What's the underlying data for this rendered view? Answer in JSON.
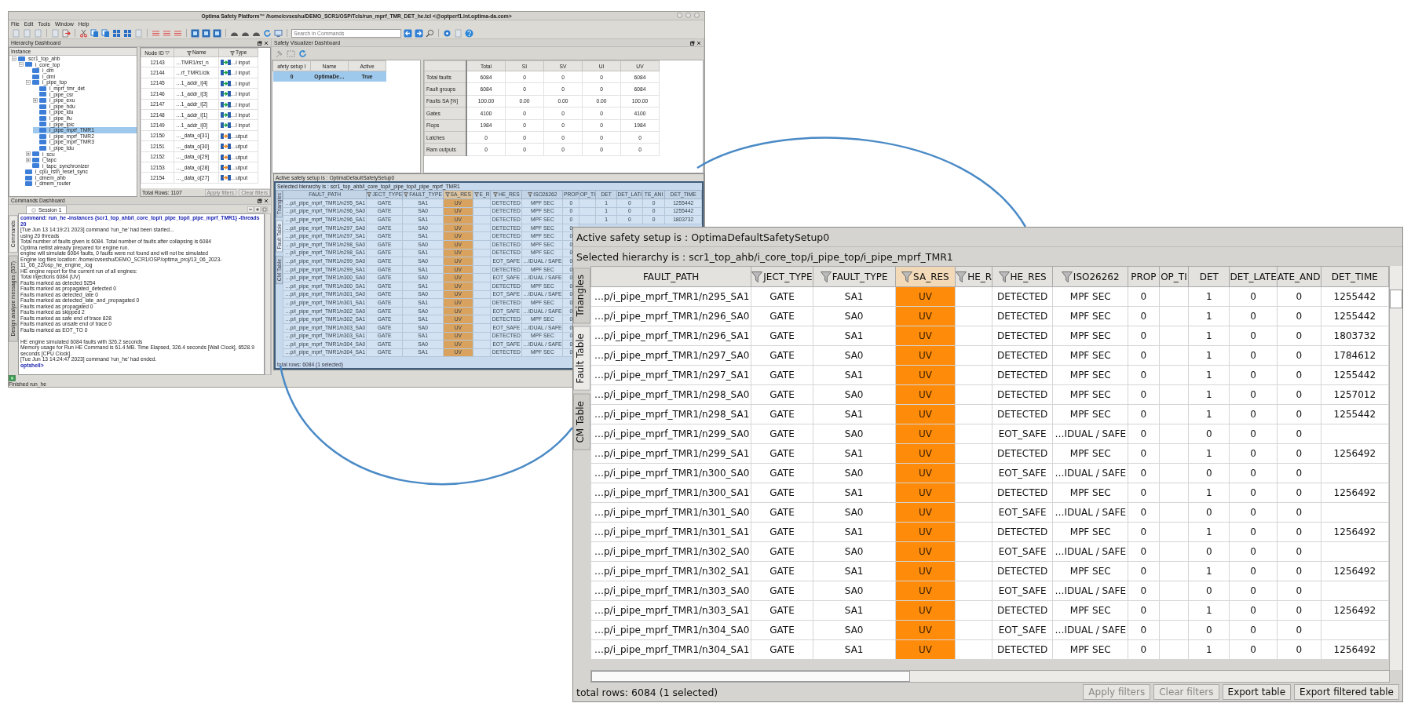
{
  "window": {
    "title": "Optima Safety Platform™ /home/cvseshu/DEMO_SCR1/OSP/Tcls/run_mprf_TMR_DET_he.tcl <@optperf1.int.optima-da.com>",
    "menu": [
      "File",
      "Edit",
      "Tools",
      "Window",
      "Help"
    ],
    "search": {
      "placeholder": "Search in Commands"
    }
  },
  "hierarchy_dashboard": {
    "title": "Hierarchy Dashboard",
    "tree": {
      "header": "Instance",
      "nodes": [
        {
          "label": "scr1_top_ahb",
          "expanded": true,
          "selected": false,
          "children": [
            {
              "label": "i_core_top",
              "expanded": true,
              "selected": false,
              "children": [
                {
                  "label": "i_dm",
                  "selected": false
                },
                {
                  "label": "i_dmi",
                  "selected": false
                },
                {
                  "label": "i_pipe_top",
                  "expanded": true,
                  "selected": false,
                  "children": [
                    {
                      "label": "i_mprf_tmr_det",
                      "selected": false
                    },
                    {
                      "label": "i_pipe_csr",
                      "selected": false
                    },
                    {
                      "label": "i_pipe_exu",
                      "expanded": false,
                      "selected": false
                    },
                    {
                      "label": "i_pipe_hdu",
                      "selected": false
                    },
                    {
                      "label": "i_pipe_idu",
                      "selected": false
                    },
                    {
                      "label": "i_pipe_ifu",
                      "selected": false
                    },
                    {
                      "label": "i_pipe_ipic",
                      "selected": false
                    },
                    {
                      "label": "i_pipe_mprf_TMR1",
                      "selected": true
                    },
                    {
                      "label": "i_pipe_mprf_TMR2",
                      "selected": false
                    },
                    {
                      "label": "i_pipe_mprf_TMR3",
                      "selected": false
                    },
                    {
                      "label": "i_pipe_tdu",
                      "selected": false
                    }
                  ]
                },
                {
                  "label": "i_scu",
                  "expanded": false,
                  "selected": false
                },
                {
                  "label": "i_tapc",
                  "expanded": false,
                  "selected": false
                },
                {
                  "label": "i_tapc_synchronizer",
                  "selected": false
                }
              ]
            },
            {
              "label": "i_cpu_rstn_reset_sync",
              "selected": false
            },
            {
              "label": "i_dmem_ahb",
              "selected": false
            },
            {
              "label": "i_dmem_router",
              "selected": false
            }
          ]
        }
      ]
    },
    "node_table": {
      "columns": [
        {
          "label": "Node ID",
          "sorted": true,
          "filter": false
        },
        {
          "label": "Name",
          "sorted": false,
          "filter": true
        },
        {
          "label": "Type",
          "sorted": false,
          "filter": true
        }
      ],
      "rows": [
        {
          "node_id": "12143",
          "name": "…TMR1/rst_n",
          "kind": "input",
          "type": "…l input"
        },
        {
          "node_id": "12144",
          "name": "…rf_TMR1/clk",
          "kind": "input",
          "type": "…l input"
        },
        {
          "node_id": "12145",
          "name": "…1_addr_i[4]",
          "kind": "input",
          "type": "…l input"
        },
        {
          "node_id": "12146",
          "name": "…1_addr_i[3]",
          "kind": "input",
          "type": "…l input"
        },
        {
          "node_id": "12147",
          "name": "…1_addr_i[2]",
          "kind": "input",
          "type": "…l input"
        },
        {
          "node_id": "12148",
          "name": "…1_addr_i[1]",
          "kind": "input",
          "type": "…l input"
        },
        {
          "node_id": "12149",
          "name": "…1_addr_i[0]",
          "kind": "input",
          "type": "…l input"
        },
        {
          "node_id": "12150",
          "name": "…_data_o[31]",
          "kind": "output",
          "type": "…utput"
        },
        {
          "node_id": "12151",
          "name": "…_data_o[30]",
          "kind": "output",
          "type": "…utput"
        },
        {
          "node_id": "12152",
          "name": "…_data_o[29]",
          "kind": "output",
          "type": "…utput"
        },
        {
          "node_id": "12153",
          "name": "…_data_o[28]",
          "kind": "output",
          "type": "…utput"
        },
        {
          "node_id": "12154",
          "name": "…_data_o[27]",
          "kind": "output",
          "type": "…utput"
        }
      ],
      "total": "Total Rows: 1107",
      "buttons": [
        {
          "label": "Apply filters",
          "disabled": true
        },
        {
          "label": "Clear filters",
          "disabled": true
        }
      ]
    }
  },
  "commands_dashboard": {
    "title": "Commands Dashboard",
    "tabs": [
      {
        "label": "Session 1",
        "selected": true
      }
    ],
    "side_tabs": [
      {
        "label": "Commands",
        "selected": true
      },
      {
        "label": "Design analyze messages (537)",
        "selected": false
      }
    ],
    "log": [
      {
        "kind": "command",
        "text": "command: run_he -instances {scr1_top_ahb/i_core_top/i_pipe_top/i_pipe_mprf_TMR1} -threads 20"
      },
      {
        "kind": "text",
        "text": "[Tue Jun 13 14:19:21 2023] command 'run_he' had been started..."
      },
      {
        "kind": "text",
        "text": "using 20 threads"
      },
      {
        "kind": "text",
        "text": "Total number of faults given is 6084. Total number of faults after collapsing is 6084"
      },
      {
        "kind": "text",
        "text": "Optima netlist already prepared for engine run."
      },
      {
        "kind": "text",
        "text": "engine will simulate 6084 faults, 0 faults were not found and will not be simulated"
      },
      {
        "kind": "text",
        "text": "Engine log files location: /home/cvseshu/DEMO_SCR1/OSP/optima_proj/13_06_2023-11_06_22/osp_he_engine_.log"
      },
      {
        "kind": "text",
        "text": "HE engine report for the current run of all engines:"
      },
      {
        "kind": "text",
        "text": "Total injections 6084 (UV)"
      },
      {
        "kind": "text",
        "text": "Faults marked as detected 5254"
      },
      {
        "kind": "text",
        "text": "Faults marked as propagated_detected 0"
      },
      {
        "kind": "text",
        "text": "Faults marked as detected_late 0"
      },
      {
        "kind": "text",
        "text": "Faults marked as detected_late_and_propagated 0"
      },
      {
        "kind": "text",
        "text": "Faults marked as propagated 0"
      },
      {
        "kind": "text",
        "text": "Faults marked as skipped 2"
      },
      {
        "kind": "text",
        "text": "Faults marked as safe end of trace 828"
      },
      {
        "kind": "text",
        "text": "Faults marked as unsafe end of trace 0"
      },
      {
        "kind": "text",
        "text": "Faults marked as EOT_TO 0"
      },
      {
        "kind": "text",
        "gap_before": true,
        "text": "HE engine simulated 6084 faults with 326.2 seconds"
      },
      {
        "kind": "text",
        "text": "Memory usage for Run HE Command is 61.4 MB. Time Elapsed, 326.4 seconds [Wall Clock], 6528.9 seconds [CPU Clock]."
      },
      {
        "kind": "text",
        "text": "[Tue Jun 13 14:24:47 2023] command 'run_he' had ended."
      },
      {
        "kind": "prompt",
        "text": "optshell>"
      }
    ]
  },
  "safety_visualizer": {
    "title": "Safety Visualizer Dashboard",
    "setups": {
      "columns": [
        "afety setup I",
        "Name",
        "Active"
      ],
      "rows": [
        {
          "cells": [
            "0",
            "OptimaDe…",
            "True"
          ],
          "selected": true
        }
      ]
    },
    "summary": {
      "columns": [
        "Total",
        "SI",
        "SV",
        "UI",
        "UV"
      ],
      "rows": [
        {
          "label": "Total faults",
          "values": [
            "6084",
            "0",
            "0",
            "0",
            "6084"
          ]
        },
        {
          "label": "Fault groups",
          "values": [
            "6084",
            "0",
            "0",
            "0",
            "6084"
          ]
        },
        {
          "label": "Faults SA [%]",
          "values": [
            "100.00",
            "0.00",
            "0.00",
            "0.00",
            "100.00"
          ]
        },
        {
          "label": "Gates",
          "values": [
            "4100",
            "0",
            "0",
            "0",
            "4100"
          ]
        },
        {
          "label": "Flops",
          "values": [
            "1984",
            "0",
            "0",
            "0",
            "1984"
          ]
        },
        {
          "label": "Latches",
          "values": [
            "0",
            "0",
            "0",
            "0",
            "0"
          ]
        },
        {
          "label": "Ram outputs",
          "values": [
            "0",
            "0",
            "0",
            "0",
            "0"
          ]
        }
      ]
    }
  },
  "fault_window": {
    "active_setup": "Active safety setup is : OptimaDefaultSafetySetup0",
    "selected_hierarchy": "Selected hierarchy is : scr1_top_ahb/i_core_top/i_pipe_top/i_pipe_mprf_TMR1",
    "side_tabs": [
      {
        "label": "Triangles",
        "selected": false
      },
      {
        "label": "Fault Table",
        "selected": true
      },
      {
        "label": "CM Table",
        "selected": false
      }
    ],
    "columns": [
      {
        "label": "FAULT_PATH",
        "filter": false,
        "highlighted": false
      },
      {
        "label": "JECT_TYPE",
        "filter": true,
        "highlighted": false
      },
      {
        "label": "FAULT_TYPE",
        "filter": true,
        "highlighted": false
      },
      {
        "label": "SA_RES",
        "filter": true,
        "highlighted": true
      },
      {
        "label": "E_R",
        "filter": true,
        "highlighted": false
      },
      {
        "label": "HE_RES",
        "filter": true,
        "highlighted": false
      },
      {
        "label": "ISO26262",
        "filter": true,
        "highlighted": false
      },
      {
        "label": "PROP",
        "filter": false,
        "highlighted": false
      },
      {
        "label": "OP_TI",
        "filter": false,
        "highlighted": false
      },
      {
        "label": "DET",
        "filter": false,
        "highlighted": false
      },
      {
        "label": "DET_LATI",
        "filter": false,
        "highlighted": false
      },
      {
        "label": "TE_ANI",
        "filter": false,
        "highlighted": false
      },
      {
        "label": "DET_TIME",
        "filter": false,
        "highlighted": false
      }
    ],
    "rows": [
      [
        "…p/i_pipe_mprf_TMR1/n295_SA1",
        "GATE",
        "SA1",
        "UV",
        null,
        "DETECTED",
        "MPF SEC",
        "0",
        null,
        "1",
        "0",
        "0",
        "1255442"
      ],
      [
        "…p/i_pipe_mprf_TMR1/n296_SA0",
        "GATE",
        "SA0",
        "UV",
        null,
        "DETECTED",
        "MPF SEC",
        "0",
        null,
        "1",
        "0",
        "0",
        "1255442"
      ],
      [
        "…p/i_pipe_mprf_TMR1/n296_SA1",
        "GATE",
        "SA1",
        "UV",
        null,
        "DETECTED",
        "MPF SEC",
        "0",
        null,
        "1",
        "0",
        "0",
        "1803732"
      ],
      [
        "…p/i_pipe_mprf_TMR1/n297_SA0",
        "GATE",
        "SA0",
        "UV",
        null,
        "DETECTED",
        "MPF SEC",
        "0"
      ],
      [
        "…p/i_pipe_mprf_TMR1/n297_SA1",
        "GATE",
        "SA1",
        "UV",
        null,
        "DETECTED",
        "MPF SEC",
        "0"
      ],
      [
        "…p/i_pipe_mprf_TMR1/n298_SA0",
        "GATE",
        "SA0",
        "UV",
        null,
        "DETECTED",
        "MPF SEC",
        "0"
      ],
      [
        "…p/i_pipe_mprf_TMR1/n298_SA1",
        "GATE",
        "SA1",
        "UV",
        null,
        "DETECTED",
        "MPF SEC",
        "0"
      ],
      [
        "…p/i_pipe_mprf_TMR1/n299_SA0",
        "GATE",
        "SA0",
        "UV",
        null,
        "EOT_SAFE",
        "…IDUAL / SAFE",
        "0"
      ],
      [
        "…p/i_pipe_mprf_TMR1/n299_SA1",
        "GATE",
        "SA1",
        "UV",
        null,
        "DETECTED",
        "MPF SEC",
        "0"
      ],
      [
        "…p/i_pipe_mprf_TMR1/n300_SA0",
        "GATE",
        "SA0",
        "UV",
        null,
        "EOT_SAFE",
        "…IDUAL / SAFE",
        "0"
      ],
      [
        "…p/i_pipe_mprf_TMR1/n300_SA1",
        "GATE",
        "SA1",
        "UV",
        null,
        "DETECTED",
        "MPF SEC",
        "0"
      ],
      [
        "…p/i_pipe_mprf_TMR1/n301_SA0",
        "GATE",
        "SA0",
        "UV",
        null,
        "EOT_SAFE",
        "…IDUAL / SAFE",
        "0"
      ],
      [
        "…p/i_pipe_mprf_TMR1/n301_SA1",
        "GATE",
        "SA1",
        "UV",
        null,
        "DETECTED",
        "MPF SEC",
        "0"
      ],
      [
        "…p/i_pipe_mprf_TMR1/n302_SA0",
        "GATE",
        "SA0",
        "UV",
        null,
        "EOT_SAFE",
        "…IDUAL / SAFE",
        "0"
      ],
      [
        "…p/i_pipe_mprf_TMR1/n302_SA1",
        "GATE",
        "SA1",
        "UV",
        null,
        "DETECTED",
        "MPF SEC",
        "0"
      ],
      [
        "…p/i_pipe_mprf_TMR1/n303_SA0",
        "GATE",
        "SA0",
        "UV",
        null,
        "EOT_SAFE",
        "…IDUAL / SAFE",
        "0"
      ],
      [
        "…p/i_pipe_mprf_TMR1/n303_SA1",
        "GATE",
        "SA1",
        "UV",
        null,
        "DETECTED",
        "MPF SEC",
        "0"
      ],
      [
        "…p/i_pipe_mprf_TMR1/n304_SA0",
        "GATE",
        "SA0",
        "UV",
        null,
        "EOT_SAFE",
        "…IDUAL / SAFE",
        "0"
      ],
      [
        "…p/i_pipe_mprf_TMR1/n304_SA1",
        "GATE",
        "SA1",
        "UV",
        null,
        "DETECTED",
        "MPF SEC",
        "0"
      ]
    ],
    "total": "total rows: 6084 (1 selected)"
  },
  "status_bar": {
    "text": "Finished run_he"
  },
  "zoom_panel": {
    "active_setup": "Active safety setup is : OptimaDefaultSafetySetup0",
    "selected_hierarchy": "Selected hierarchy is : scr1_top_ahb/i_core_top/i_pipe_top/i_pipe_mprf_TMR1",
    "side_tabs": [
      {
        "label": "Triangles",
        "selected": false
      },
      {
        "label": "Fault Table",
        "selected": true
      },
      {
        "label": "CM Table",
        "selected": false
      }
    ],
    "columns": [
      {
        "label": "FAULT_PATH",
        "filter": false,
        "highlighted": false
      },
      {
        "label": "JECT_TYPE",
        "filter": true,
        "highlighted": false
      },
      {
        "label": "FAULT_TYPE",
        "filter": true,
        "highlighted": false
      },
      {
        "label": "SA_RES",
        "filter": true,
        "highlighted": true
      },
      {
        "label": "HE_R",
        "filter": true,
        "highlighted": false
      },
      {
        "label": "HE_RES",
        "filter": true,
        "highlighted": false
      },
      {
        "label": "ISO26262",
        "filter": true,
        "highlighted": false
      },
      {
        "label": "PROP",
        "filter": false,
        "highlighted": false
      },
      {
        "label": "OP_TI",
        "filter": false,
        "highlighted": false
      },
      {
        "label": "DET",
        "filter": false,
        "highlighted": false
      },
      {
        "label": "DET_LATE",
        "filter": false,
        "highlighted": false
      },
      {
        "label": "ATE_AND",
        "filter": false,
        "highlighted": false
      },
      {
        "label": "DET_TIME",
        "filter": false,
        "highlighted": false
      }
    ],
    "rows": [
      [
        "…p/i_pipe_mprf_TMR1/n295_SA1",
        "GATE",
        "SA1",
        "UV",
        null,
        "DETECTED",
        "MPF SEC",
        "0",
        null,
        "1",
        "0",
        "0",
        "1255442"
      ],
      [
        "…p/i_pipe_mprf_TMR1/n296_SA0",
        "GATE",
        "SA0",
        "UV",
        null,
        "DETECTED",
        "MPF SEC",
        "0",
        null,
        "1",
        "0",
        "0",
        "1255442"
      ],
      [
        "…p/i_pipe_mprf_TMR1/n296_SA1",
        "GATE",
        "SA1",
        "UV",
        null,
        "DETECTED",
        "MPF SEC",
        "0",
        null,
        "1",
        "0",
        "0",
        "1803732"
      ],
      [
        "…p/i_pipe_mprf_TMR1/n297_SA0",
        "GATE",
        "SA0",
        "UV",
        null,
        "DETECTED",
        "MPF SEC",
        "0",
        null,
        "1",
        "0",
        "0",
        "1784612"
      ],
      [
        "…p/i_pipe_mprf_TMR1/n297_SA1",
        "GATE",
        "SA1",
        "UV",
        null,
        "DETECTED",
        "MPF SEC",
        "0",
        null,
        "1",
        "0",
        "0",
        "1255442"
      ],
      [
        "…p/i_pipe_mprf_TMR1/n298_SA0",
        "GATE",
        "SA0",
        "UV",
        null,
        "DETECTED",
        "MPF SEC",
        "0",
        null,
        "1",
        "0",
        "0",
        "1257012"
      ],
      [
        "…p/i_pipe_mprf_TMR1/n298_SA1",
        "GATE",
        "SA1",
        "UV",
        null,
        "DETECTED",
        "MPF SEC",
        "0",
        null,
        "1",
        "0",
        "0",
        "1255442"
      ],
      [
        "…p/i_pipe_mprf_TMR1/n299_SA0",
        "GATE",
        "SA0",
        "UV",
        null,
        "EOT_SAFE",
        "…IDUAL / SAFE",
        "0",
        null,
        "0",
        "0",
        "0",
        null
      ],
      [
        "…p/i_pipe_mprf_TMR1/n299_SA1",
        "GATE",
        "SA1",
        "UV",
        null,
        "DETECTED",
        "MPF SEC",
        "0",
        null,
        "1",
        "0",
        "0",
        "1256492"
      ],
      [
        "…p/i_pipe_mprf_TMR1/n300_SA0",
        "GATE",
        "SA0",
        "UV",
        null,
        "EOT_SAFE",
        "…IDUAL / SAFE",
        "0",
        null,
        "0",
        "0",
        "0",
        null
      ],
      [
        "…p/i_pipe_mprf_TMR1/n300_SA1",
        "GATE",
        "SA1",
        "UV",
        null,
        "DETECTED",
        "MPF SEC",
        "0",
        null,
        "1",
        "0",
        "0",
        "1256492"
      ],
      [
        "…p/i_pipe_mprf_TMR1/n301_SA0",
        "GATE",
        "SA0",
        "UV",
        null,
        "EOT_SAFE",
        "…IDUAL / SAFE",
        "0",
        null,
        "0",
        "0",
        "0",
        null
      ],
      [
        "…p/i_pipe_mprf_TMR1/n301_SA1",
        "GATE",
        "SA1",
        "UV",
        null,
        "DETECTED",
        "MPF SEC",
        "0",
        null,
        "1",
        "0",
        "0",
        "1256492"
      ],
      [
        "…p/i_pipe_mprf_TMR1/n302_SA0",
        "GATE",
        "SA0",
        "UV",
        null,
        "EOT_SAFE",
        "…IDUAL / SAFE",
        "0",
        null,
        "0",
        "0",
        "0",
        null
      ],
      [
        "…p/i_pipe_mprf_TMR1/n302_SA1",
        "GATE",
        "SA1",
        "UV",
        null,
        "DETECTED",
        "MPF SEC",
        "0",
        null,
        "1",
        "0",
        "0",
        "1256492"
      ],
      [
        "…p/i_pipe_mprf_TMR1/n303_SA0",
        "GATE",
        "SA0",
        "UV",
        null,
        "EOT_SAFE",
        "…IDUAL / SAFE",
        "0",
        null,
        "0",
        "0",
        "0",
        null
      ],
      [
        "…p/i_pipe_mprf_TMR1/n303_SA1",
        "GATE",
        "SA1",
        "UV",
        null,
        "DETECTED",
        "MPF SEC",
        "0",
        null,
        "1",
        "0",
        "0",
        "1256492"
      ],
      [
        "…p/i_pipe_mprf_TMR1/n304_SA0",
        "GATE",
        "SA0",
        "UV",
        null,
        "EOT_SAFE",
        "…IDUAL / SAFE",
        "0",
        null,
        "0",
        "0",
        "0",
        null
      ],
      [
        "…p/i_pipe_mprf_TMR1/n304_SA1",
        "GATE",
        "SA1",
        "UV",
        null,
        "DETECTED",
        "MPF SEC",
        "0",
        null,
        "1",
        "0",
        "0",
        "1256492"
      ]
    ],
    "total": "total rows: 6084 (1 selected)",
    "buttons": [
      {
        "label": "Apply filters",
        "disabled": true
      },
      {
        "label": "Clear filters",
        "disabled": true
      },
      {
        "label": "Export table",
        "disabled": false
      },
      {
        "label": "Export filtered table",
        "disabled": false
      }
    ]
  }
}
